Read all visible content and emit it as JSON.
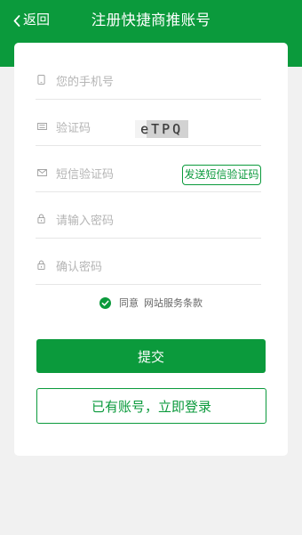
{
  "colors": {
    "brand": "#0b9a3c",
    "page_background": "#f1f1f1",
    "card_background": "#ffffff",
    "placeholder": "#b5b5b5",
    "icon": "#999999"
  },
  "header": {
    "back_icon": "chevron-left-icon",
    "back_label": "返回",
    "title": "注册快捷商推账号"
  },
  "form": {
    "phone": {
      "icon": "phone-icon",
      "placeholder": "您的手机号"
    },
    "captcha": {
      "icon": "id-card-icon",
      "placeholder": "验证码",
      "image_text": "eTPQ"
    },
    "sms_code": {
      "icon": "mail-icon",
      "placeholder": "短信验证码",
      "send_button_label": "发送短信验证码"
    },
    "password": {
      "icon": "lock-icon",
      "placeholder": "请输入密码"
    },
    "confirm_password": {
      "icon": "lock-icon",
      "placeholder": "确认密码"
    }
  },
  "agreement": {
    "checked": true,
    "check_icon": "check-circle-icon",
    "prefix": "同意",
    "terms_link": "网站服务条款"
  },
  "actions": {
    "submit_label": "提交",
    "login_label": "已有账号，立即登录"
  }
}
